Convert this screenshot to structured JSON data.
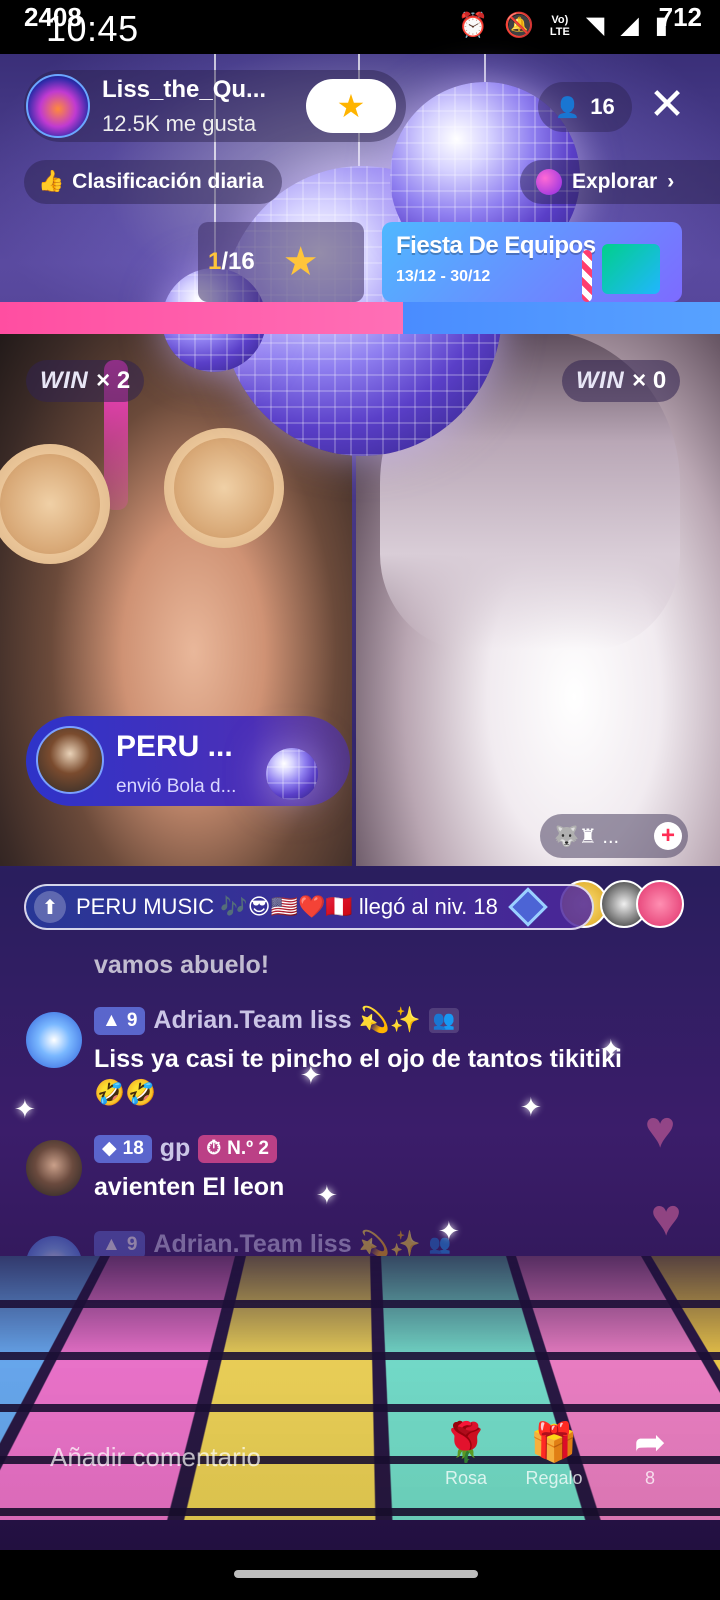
{
  "status_bar": {
    "time": "10:45",
    "icons": [
      "alarm-icon",
      "bell-off-icon",
      "volte-icon",
      "wifi-icon",
      "signal-icon",
      "battery-icon"
    ],
    "lte_label": "Vo) LTE"
  },
  "header": {
    "host_name": "Liss_the_Qu...",
    "likes": "12.5K me gusta",
    "viewer_count": "16",
    "daily_rank": "Clasificación diaria",
    "explore": "Explorar"
  },
  "battle": {
    "counter": "/16",
    "counter_highlight": "1",
    "event_title": "Fiesta De Equipos",
    "event_dates": "13/12 - 30/12",
    "score_left": "2408",
    "score_right": "712",
    "win_label": "WIN",
    "win_left": "× 2",
    "win_right": "× 0",
    "left_share": 0.56
  },
  "gift_notice": {
    "sender": "PERU ...",
    "text": "envió Bola d..."
  },
  "cohost": {
    "label": "🐺♜ ..."
  },
  "ticker": {
    "text": "PERU MUSIC 🎶😎🇺🇸❤️🇵🇪 llegó al niv. 18"
  },
  "chat": {
    "partial_line": "vamos abuelo!",
    "messages": [
      {
        "level": "9",
        "user": "Adrian.Team liss 💫✨",
        "text": "Liss ya casi te pincho el ojo de tantos tikitiki",
        "text2": "🤣🤣"
      },
      {
        "level": "18",
        "user": "gp",
        "rank_badge": "N.º 2",
        "text": "avienten  El leon"
      },
      {
        "level": "9",
        "user": "Adrian.Team liss 💫✨"
      }
    ]
  },
  "toolbar": {
    "comment_placeholder": "Añadir comentario",
    "rose_label": "Rosa",
    "gift_label": "Regalo",
    "share_count": "8"
  },
  "colors": {
    "score_left": "#ff4ea1",
    "score_right": "#4a8cff",
    "gold": "#ffc53a"
  }
}
